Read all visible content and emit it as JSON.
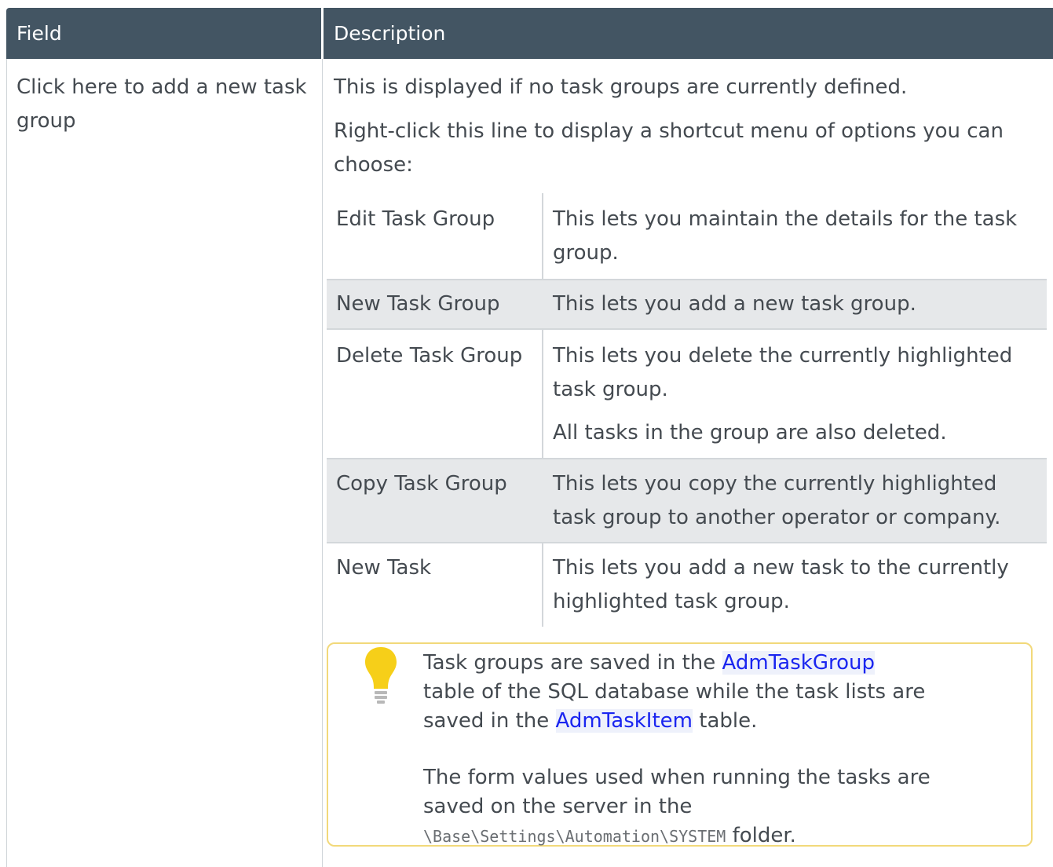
{
  "table": {
    "header": {
      "field": "Field",
      "description": "Description"
    },
    "field_label": "Click here to add a new task group",
    "desc_para1": "This is displayed if no task groups are currently defined.",
    "desc_para2": "Right-click this line to display a shortcut menu of options you can choose:"
  },
  "menu_options": [
    {
      "name": "Edit Task Group",
      "desc": "This lets you maintain the details for the task group."
    },
    {
      "name": "New Task Group",
      "desc": "This lets you add a new task group."
    },
    {
      "name": "Delete Task Group",
      "desc": "This lets you delete the currently highlighted task group.",
      "desc_extra": "All tasks in the group are also deleted."
    },
    {
      "name": "Copy Task Group",
      "desc": "This lets you copy the currently highlighted task group to another operator or company."
    },
    {
      "name": "New Task",
      "desc": "This lets you add a new task to the currently highlighted task group."
    }
  ],
  "note": {
    "icon": "lightbulb-icon",
    "line1_pre": "Task groups are saved in the",
    "link1": "AdmTaskGroup",
    "line1_mid": "table of the SQL database while the task lists are saved in the",
    "link2": "AdmTaskItem",
    "line1_post": "table.",
    "line2_pre": "The form values used when running the tasks are saved on the server in the",
    "path": "\\Base\\Settings\\Automation\\SYSTEM",
    "line2_post": "folder."
  },
  "colors": {
    "header_bg": "#435563",
    "shaded_row": "#e6e8ea",
    "link": "#1a25f0",
    "note_border": "#f2d97a",
    "bulb": "#f6cf19"
  }
}
